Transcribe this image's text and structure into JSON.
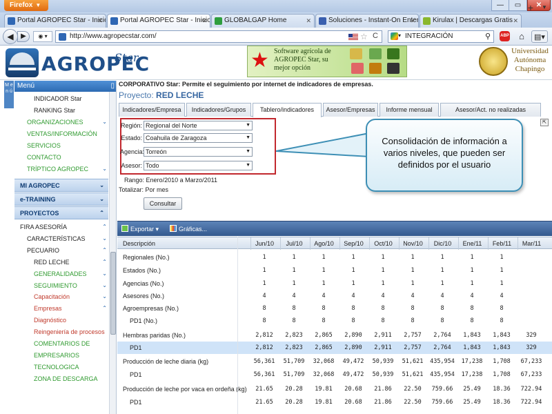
{
  "browser": {
    "app_button": "Firefox",
    "tabs": [
      {
        "label": "Portal AGROPEC Star - Inicio",
        "active": false,
        "fav_color": "#2f67b4"
      },
      {
        "label": "Portal AGROPEC Star - Inicio",
        "active": true,
        "fav_color": "#2f67b4"
      },
      {
        "label": "GLOBALGAP Home",
        "active": false,
        "fav_color": "#2e9e3e"
      },
      {
        "label": "Soluciones - Instant-On Enterpri...",
        "active": false,
        "fav_color": "#3a5fae"
      },
      {
        "label": "Kirulax | Descargas Gratis",
        "active": false,
        "fav_color": "#8ab72d"
      }
    ],
    "url": "http://www.agropecstar.com/",
    "search_text": "INTEGRACIÓN",
    "abp_label": "ABP",
    "icons": {
      "back": "back-arrow-icon",
      "forward": "forward-arrow-icon",
      "star": "bookmark-star-icon",
      "refresh": "refresh-icon",
      "search": "magnifier-icon",
      "home": "home-icon"
    }
  },
  "header": {
    "logo_word": "AGROPEC",
    "logo_star": "Star",
    "ad_text": "Software agrícola de AGROPEC Star, su mejor opción",
    "university": "Universidad Autónoma Chapingo"
  },
  "sidebar": {
    "vertical_tab": "M e n ú",
    "menu_title": "Menú",
    "menu_pin": "▯",
    "items": [
      {
        "label": "INDICADOR Star",
        "indent": 2,
        "color": "#222",
        "chev": ""
      },
      {
        "label": "RANKING Star",
        "indent": 2,
        "color": "#222",
        "chev": ""
      },
      {
        "label": "ORGANIZACIONES",
        "indent": 1,
        "color": "#2f9a2f",
        "chev": "⌄"
      },
      {
        "label": "VENTAS/INFORMACIÓN",
        "indent": 1,
        "color": "#2f9a2f",
        "chev": ""
      },
      {
        "label": "SERVICIOS",
        "indent": 1,
        "color": "#2f9a2f",
        "chev": ""
      },
      {
        "label": "CONTACTO",
        "indent": 1,
        "color": "#2f9a2f",
        "chev": ""
      },
      {
        "label": "TRÍPTICO AGROPEC",
        "indent": 1,
        "color": "#2f9a2f",
        "chev": "⌄"
      }
    ],
    "sections": [
      {
        "label": "MI AGROPEC",
        "chev": "⌄"
      },
      {
        "label": "e-TRAINING",
        "chev": "⌄"
      },
      {
        "label": "PROYECTOS",
        "chev": "⌃"
      }
    ],
    "project_items": [
      {
        "label": "FIRA ASESORÍA",
        "indent": 0,
        "color": "#222",
        "chev": "⌃"
      },
      {
        "label": "CARACTERÍSTICAS",
        "indent": 1,
        "color": "#222",
        "chev": "⌄"
      },
      {
        "label": "PECUARIO",
        "indent": 1,
        "color": "#222",
        "chev": "⌃"
      },
      {
        "label": "RED LECHE",
        "indent": 2,
        "color": "#222",
        "chev": "⌃"
      },
      {
        "label": "GENERALIDADES",
        "indent": 2,
        "color": "#2f9a2f",
        "chev": "⌄"
      },
      {
        "label": "SEGUIMIENTO",
        "indent": 2,
        "color": "#2f9a2f",
        "chev": "⌄"
      },
      {
        "label": "Capacitación",
        "indent": 2,
        "color": "#c0392b",
        "chev": "⌄"
      },
      {
        "label": "Empresas",
        "indent": 2,
        "color": "#c0392b",
        "chev": "⌃"
      },
      {
        "label": "Diagnóstico",
        "indent": 2,
        "color": "#c0392b",
        "chev": ""
      },
      {
        "label": "Reingeniería de procesos",
        "indent": 2,
        "color": "#c0392b",
        "chev": ""
      },
      {
        "label": "COMENTARIOS DE",
        "indent": 2,
        "color": "#2f9a2f",
        "chev": ""
      },
      {
        "label": "EMPRESARIOS",
        "indent": 2,
        "color": "#2f9a2f",
        "chev": ""
      },
      {
        "label": "TECNOLOGICA",
        "indent": 2,
        "color": "#2f9a2f",
        "chev": ""
      },
      {
        "label": "ZONA DE DESCARGA",
        "indent": 2,
        "color": "#2f9a2f",
        "chev": ""
      }
    ]
  },
  "main": {
    "corp_line": "CORPORATIVO Star: Permite el seguimiento por internet de indicadores de empresas.",
    "project_prefix": "Proyecto:",
    "project_name": "RED LECHE",
    "tabs": [
      {
        "label": "Indicadores/Empresa",
        "active": false
      },
      {
        "label": "Indicadores/Grupos",
        "active": false
      },
      {
        "label": "Tablero/indicadores",
        "active": true
      },
      {
        "label": "Asesor/Empresas",
        "active": false
      },
      {
        "label": "Informe mensual",
        "active": false
      },
      {
        "label": "Asesor/Act. no realizadas",
        "active": false
      }
    ],
    "filters": [
      {
        "label": "Región:",
        "value": "Regional del Norte"
      },
      {
        "label": "Estado:",
        "value": "Coahuila de Zaragoza"
      },
      {
        "label": "Agencia:",
        "value": "Torreón"
      },
      {
        "label": "Asesor:",
        "value": "Todo"
      }
    ],
    "rango_label": "Rango:",
    "rango_value": "Enero/2010 a Marzo/2011",
    "totalizar_label": "Totalizar:",
    "totalizar_value": "Por mes",
    "consultar": "Consultar",
    "callout": "Consolidación de información a varios niveles, que pueden ser definidos por el usuario",
    "export_label": "Exportar",
    "graficas_label": "Gráficas...",
    "accent_red": "#c1272d",
    "callout_border": "#3d8fb5"
  },
  "grid": {
    "desc_header": "Descripción",
    "months": [
      "Jun/10",
      "Jul/10",
      "Ago/10",
      "Sep/10",
      "Oct/10",
      "Nov/10",
      "Dic/10",
      "Ene/11",
      "Feb/11",
      "Mar/11"
    ],
    "rows": [
      {
        "desc": "Regionales (No.)",
        "sub": false,
        "hl": false,
        "values": [
          "1",
          "1",
          "1",
          "1",
          "1",
          "1",
          "1",
          "1",
          "1"
        ]
      },
      {
        "desc": "Estados (No.)",
        "sub": false,
        "hl": false,
        "values": [
          "1",
          "1",
          "1",
          "1",
          "1",
          "1",
          "1",
          "1",
          "1"
        ]
      },
      {
        "desc": "Agencias (No.)",
        "sub": false,
        "hl": false,
        "values": [
          "1",
          "1",
          "1",
          "1",
          "1",
          "1",
          "1",
          "1",
          "1"
        ]
      },
      {
        "desc": "Asesores (No.)",
        "sub": false,
        "hl": false,
        "values": [
          "4",
          "4",
          "4",
          "4",
          "4",
          "4",
          "4",
          "4",
          "4"
        ]
      },
      {
        "desc": "Agroempresas (No.)",
        "sub": false,
        "hl": false,
        "values": [
          "8",
          "8",
          "8",
          "8",
          "8",
          "8",
          "8",
          "8",
          "8"
        ]
      },
      {
        "desc": "PD1 (No.)",
        "sub": true,
        "hl": false,
        "values": [
          "8",
          "8",
          "8",
          "8",
          "8",
          "8",
          "8",
          "8",
          "8"
        ]
      },
      {
        "desc": "Hembras paridas (No.)",
        "sub": false,
        "hl": false,
        "values": [
          "2,812",
          "2,823",
          "2,865",
          "2,890",
          "2,911",
          "2,757",
          "2,764",
          "1,843",
          "1,843",
          "329"
        ]
      },
      {
        "desc": "PD1",
        "sub": true,
        "hl": true,
        "values": [
          "2,812",
          "2,823",
          "2,865",
          "2,890",
          "2,911",
          "2,757",
          "2,764",
          "1,843",
          "1,843",
          "329"
        ]
      },
      {
        "desc": "Producción de leche diaria (kg)",
        "sub": false,
        "hl": false,
        "values": [
          "56,361",
          "51,709",
          "32,068",
          "49,472",
          "50,939",
          "51,621",
          "435,954",
          "17,238",
          "1,708",
          "67,233"
        ]
      },
      {
        "desc": "PD1",
        "sub": true,
        "hl": false,
        "values": [
          "56,361",
          "51,709",
          "32,068",
          "49,472",
          "50,939",
          "51,621",
          "435,954",
          "17,238",
          "1,708",
          "67,233"
        ]
      },
      {
        "desc": "Producción de leche por vaca en ordeña (kg)",
        "sub": false,
        "hl": false,
        "values": [
          "21.65",
          "20.28",
          "19.81",
          "20.68",
          "21.86",
          "22.50",
          "759.66",
          "25.49",
          "18.36",
          "722.94"
        ]
      },
      {
        "desc": "PD1",
        "sub": true,
        "hl": false,
        "values": [
          "21.65",
          "20.28",
          "19.81",
          "20.68",
          "21.86",
          "22.50",
          "759.66",
          "25.49",
          "18.36",
          "722.94"
        ]
      }
    ]
  }
}
